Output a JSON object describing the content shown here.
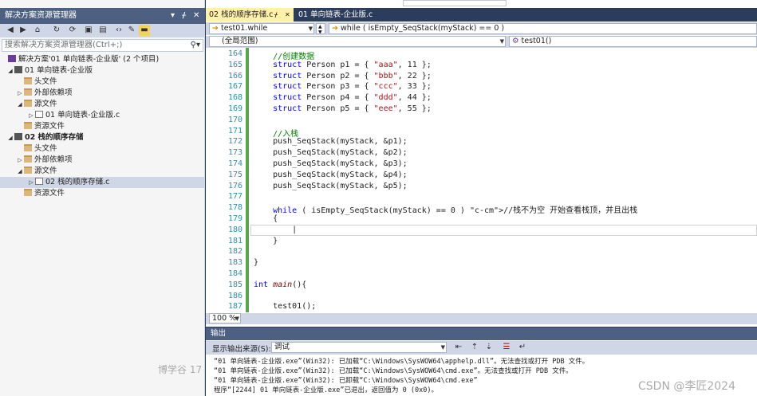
{
  "solution_explorer": {
    "title": "解决方案资源管理器",
    "search_placeholder": "搜索解决方案资源管理器(Ctrl+;)",
    "tree": [
      {
        "label": "解决方案'01 单向链表-企业版' (2 个项目)",
        "icon": "solution-icon",
        "expander": ""
      },
      {
        "label": "01 单向链表-企业版",
        "icon": "project-icon",
        "expander": "◢"
      },
      {
        "label": "头文件",
        "icon": "folder-icon",
        "expander": ""
      },
      {
        "label": "外部依赖项",
        "icon": "folder-icon",
        "expander": "▷"
      },
      {
        "label": "源文件",
        "icon": "folder-icon",
        "expander": "◢"
      },
      {
        "label": "01 单向链表-企业版.c",
        "icon": "c-file-icon",
        "expander": "▷"
      },
      {
        "label": "资源文件",
        "icon": "folder-icon",
        "expander": ""
      },
      {
        "label": "02 栈的顺序存储",
        "icon": "project-icon",
        "expander": "◢",
        "bold": true
      },
      {
        "label": "头文件",
        "icon": "folder-icon",
        "expander": ""
      },
      {
        "label": "外部依赖项",
        "icon": "folder-icon",
        "expander": "▷"
      },
      {
        "label": "源文件",
        "icon": "folder-icon",
        "expander": "◢"
      },
      {
        "label": "02 栈的顺序存储.c",
        "icon": "c-file-icon",
        "expander": "▷",
        "selected": true
      },
      {
        "label": "资源文件",
        "icon": "folder-icon",
        "expander": ""
      }
    ]
  },
  "editor": {
    "tabs": [
      {
        "label": "02 栈的顺序存储.c",
        "active": true
      },
      {
        "label": "01 单向链表-企业版.c",
        "active": false
      }
    ],
    "nav": {
      "scope_func": "test01.while",
      "scope_block": "while ( isEmpty_SeqStack(myStack) == 0 )",
      "global_scope": "(全局范围)",
      "member": "test01()"
    },
    "zoom": "100 %",
    "lines": [
      {
        "no": "164",
        "text": "    //创建数据",
        "kind": "comment"
      },
      {
        "no": "165",
        "text": "    struct Person p1 = { \"aaa\", 11 };",
        "kind": "struct"
      },
      {
        "no": "166",
        "text": "    struct Person p2 = { \"bbb\", 22 };",
        "kind": "struct"
      },
      {
        "no": "167",
        "text": "    struct Person p3 = { \"ccc\", 33 };",
        "kind": "struct"
      },
      {
        "no": "168",
        "text": "    struct Person p4 = { \"ddd\", 44 };",
        "kind": "struct"
      },
      {
        "no": "169",
        "text": "    struct Person p5 = { \"eee\", 55 };",
        "kind": "struct"
      },
      {
        "no": "170",
        "text": "",
        "kind": "plain"
      },
      {
        "no": "171",
        "text": "    //入栈",
        "kind": "comment"
      },
      {
        "no": "172",
        "text": "    push_SeqStack(myStack, &p1);",
        "kind": "call"
      },
      {
        "no": "173",
        "text": "    push_SeqStack(myStack, &p2);",
        "kind": "call"
      },
      {
        "no": "174",
        "text": "    push_SeqStack(myStack, &p3);",
        "kind": "call"
      },
      {
        "no": "175",
        "text": "    push_SeqStack(myStack, &p4);",
        "kind": "call"
      },
      {
        "no": "176",
        "text": "    push_SeqStack(myStack, &p5);",
        "kind": "call"
      },
      {
        "no": "177",
        "text": "",
        "kind": "plain"
      },
      {
        "no": "178",
        "text": "    while ( isEmpty_SeqStack(myStack) == 0 ) //栈不为空 开始查看栈顶，并且出栈",
        "kind": "while"
      },
      {
        "no": "179",
        "text": "    {",
        "kind": "plain"
      },
      {
        "no": "180",
        "text": "        |",
        "kind": "current"
      },
      {
        "no": "181",
        "text": "    }",
        "kind": "plain"
      },
      {
        "no": "182",
        "text": "",
        "kind": "plain"
      },
      {
        "no": "183",
        "text": "}",
        "kind": "plain"
      },
      {
        "no": "184",
        "text": "",
        "kind": "plain"
      },
      {
        "no": "185",
        "text": "int main(){",
        "kind": "main"
      },
      {
        "no": "186",
        "text": "",
        "kind": "plain"
      },
      {
        "no": "187",
        "text": "    test01();",
        "kind": "plain"
      }
    ]
  },
  "output": {
    "title": "输出",
    "source_label": "显示输出来源(S):",
    "source_value": "调试",
    "lines": [
      "“01 单向链表-企业版.exe”(Win32): 已加载“C:\\Windows\\SysWOW64\\apphelp.dll”。无法查找或打开 PDB 文件。",
      "“01 单向链表-企业版.exe”(Win32): 已加载“C:\\Windows\\SysWOW64\\cmd.exe”。无法查找或打开 PDB 文件。",
      "“01 单向链表-企业版.exe”(Win32): 已卸载“C:\\Windows\\SysWOW64\\cmd.exe”",
      "程序“[2244] 01 单向链表-企业版.exe”已退出，返回值为 0 (0x0)。"
    ]
  },
  "watermarks": {
    "left": "博学谷 17",
    "right": "CSDN @李匠2024"
  }
}
